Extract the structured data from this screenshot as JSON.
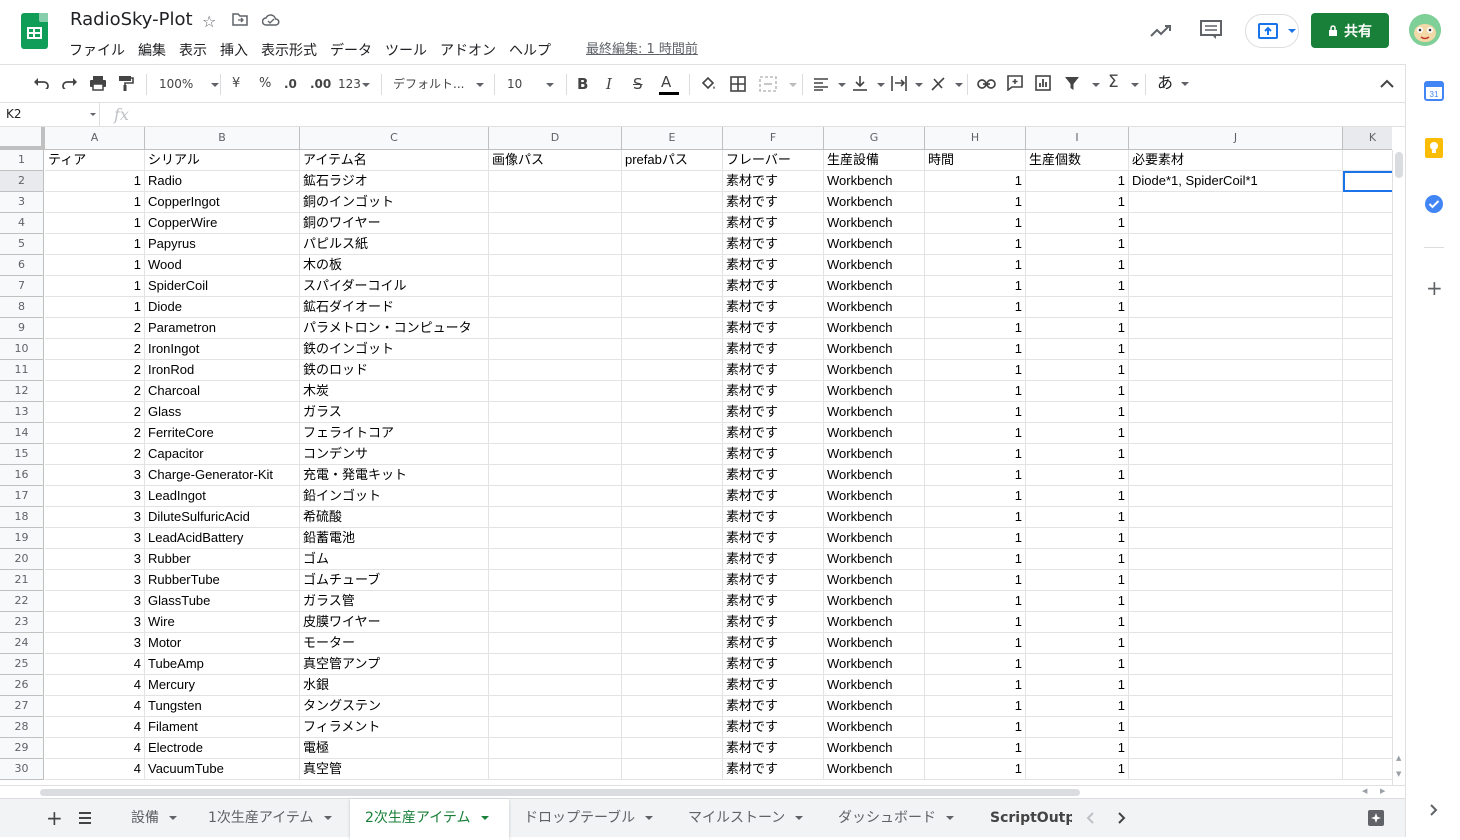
{
  "app": {
    "doc_title": "RadioSky-Plot",
    "last_edit": "最終編集: 1 時間前",
    "share_label": "共有",
    "menu": [
      "ファイル",
      "編集",
      "表示",
      "挿入",
      "表示形式",
      "データ",
      "ツール",
      "アドオン",
      "ヘルプ"
    ]
  },
  "toolbar": {
    "zoom": "100%",
    "currency": "¥",
    "percent": "%",
    "dec_decrease": ".0",
    "dec_increase": ".00",
    "format_more": "123",
    "font": "デフォルト...",
    "font_size": "10",
    "bold": "B",
    "italic": "I",
    "strike": "S",
    "text_color": "A",
    "input_tools": "あ"
  },
  "formula_bar": {
    "name_box": "K2",
    "fx": "fx"
  },
  "columns": [
    "A",
    "B",
    "C",
    "D",
    "E",
    "F",
    "G",
    "H",
    "I",
    "J",
    "K"
  ],
  "header_row": [
    "ティア",
    "シリアル",
    "アイテム名",
    "画像パス",
    "prefabパス",
    "フレーバー",
    "生産設備",
    "時間",
    "生産個数",
    "必要素材",
    ""
  ],
  "rows": [
    [
      "1",
      "Radio",
      "鉱石ラジオ",
      "",
      "",
      "素材です",
      "Workbench",
      "1",
      "1",
      "Diode*1, SpiderCoil*1"
    ],
    [
      "1",
      "CopperIngot",
      "銅のインゴット",
      "",
      "",
      "素材です",
      "Workbench",
      "1",
      "1",
      ""
    ],
    [
      "1",
      "CopperWire",
      "銅のワイヤー",
      "",
      "",
      "素材です",
      "Workbench",
      "1",
      "1",
      ""
    ],
    [
      "1",
      "Papyrus",
      "パピルス紙",
      "",
      "",
      "素材です",
      "Workbench",
      "1",
      "1",
      ""
    ],
    [
      "1",
      "Wood",
      "木の板",
      "",
      "",
      "素材です",
      "Workbench",
      "1",
      "1",
      ""
    ],
    [
      "1",
      "SpiderCoil",
      "スパイダーコイル",
      "",
      "",
      "素材です",
      "Workbench",
      "1",
      "1",
      ""
    ],
    [
      "1",
      "Diode",
      "鉱石ダイオード",
      "",
      "",
      "素材です",
      "Workbench",
      "1",
      "1",
      ""
    ],
    [
      "2",
      "Parametron",
      "パラメトロン・コンピュータ",
      "",
      "",
      "素材です",
      "Workbench",
      "1",
      "1",
      ""
    ],
    [
      "2",
      "IronIngot",
      "鉄のインゴット",
      "",
      "",
      "素材です",
      "Workbench",
      "1",
      "1",
      ""
    ],
    [
      "2",
      "IronRod",
      "鉄のロッド",
      "",
      "",
      "素材です",
      "Workbench",
      "1",
      "1",
      ""
    ],
    [
      "2",
      "Charcoal",
      "木炭",
      "",
      "",
      "素材です",
      "Workbench",
      "1",
      "1",
      ""
    ],
    [
      "2",
      "Glass",
      "ガラス",
      "",
      "",
      "素材です",
      "Workbench",
      "1",
      "1",
      ""
    ],
    [
      "2",
      "FerriteCore",
      "フェライトコア",
      "",
      "",
      "素材です",
      "Workbench",
      "1",
      "1",
      ""
    ],
    [
      "2",
      "Capacitor",
      "コンデンサ",
      "",
      "",
      "素材です",
      "Workbench",
      "1",
      "1",
      ""
    ],
    [
      "3",
      "Charge-Generator-Kit",
      "充電・発電キット",
      "",
      "",
      "素材です",
      "Workbench",
      "1",
      "1",
      ""
    ],
    [
      "3",
      "LeadIngot",
      "鉛インゴット",
      "",
      "",
      "素材です",
      "Workbench",
      "1",
      "1",
      ""
    ],
    [
      "3",
      "DiluteSulfuricAcid",
      "希硫酸",
      "",
      "",
      "素材です",
      "Workbench",
      "1",
      "1",
      ""
    ],
    [
      "3",
      "LeadAcidBattery",
      "鉛蓄電池",
      "",
      "",
      "素材です",
      "Workbench",
      "1",
      "1",
      ""
    ],
    [
      "3",
      "Rubber",
      "ゴム",
      "",
      "",
      "素材です",
      "Workbench",
      "1",
      "1",
      ""
    ],
    [
      "3",
      "RubberTube",
      "ゴムチューブ",
      "",
      "",
      "素材です",
      "Workbench",
      "1",
      "1",
      ""
    ],
    [
      "3",
      "GlassTube",
      "ガラス管",
      "",
      "",
      "素材です",
      "Workbench",
      "1",
      "1",
      ""
    ],
    [
      "3",
      "Wire",
      "皮膜ワイヤー",
      "",
      "",
      "素材です",
      "Workbench",
      "1",
      "1",
      ""
    ],
    [
      "3",
      "Motor",
      "モーター",
      "",
      "",
      "素材です",
      "Workbench",
      "1",
      "1",
      ""
    ],
    [
      "4",
      "TubeAmp",
      "真空管アンプ",
      "",
      "",
      "素材です",
      "Workbench",
      "1",
      "1",
      ""
    ],
    [
      "4",
      "Mercury",
      "水銀",
      "",
      "",
      "素材です",
      "Workbench",
      "1",
      "1",
      ""
    ],
    [
      "4",
      "Tungsten",
      "タングステン",
      "",
      "",
      "素材です",
      "Workbench",
      "1",
      "1",
      ""
    ],
    [
      "4",
      "Filament",
      "フィラメント",
      "",
      "",
      "素材です",
      "Workbench",
      "1",
      "1",
      ""
    ],
    [
      "4",
      "Electrode",
      "電極",
      "",
      "",
      "素材です",
      "Workbench",
      "1",
      "1",
      ""
    ],
    [
      "4",
      "VacuumTube",
      "真空管",
      "",
      "",
      "素材です",
      "Workbench",
      "1",
      "1",
      ""
    ]
  ],
  "sheet_tabs": [
    "設備",
    "1次生産アイテム",
    "2次生産アイテム",
    "ドロップテーブル",
    "マイルストーン",
    "ダッシュボード",
    "ScriptOutput"
  ],
  "active_tab": "2次生産アイテム",
  "colors": {
    "brand_green": "#0f9d58",
    "share_green": "#188038",
    "selection_blue": "#1a73e8"
  }
}
